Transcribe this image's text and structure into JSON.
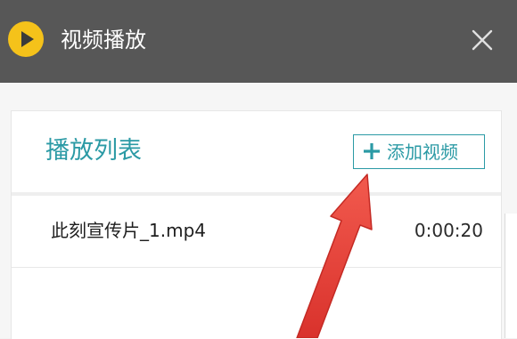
{
  "window": {
    "title": "视频播放",
    "icon": "play-icon",
    "close_icon": "close-icon",
    "titlebar_color": "#575757",
    "accent_color": "#2b9aa5"
  },
  "playlist": {
    "title": "播放列表",
    "add_button_label": "添加视频",
    "add_button_icon": "plus-icon",
    "items": [
      {
        "name": "此刻宣传片_1.mp4",
        "duration": "0:00:20"
      }
    ]
  },
  "annotation": {
    "icon": "red-arrow-icon",
    "color": "#e8433a"
  }
}
